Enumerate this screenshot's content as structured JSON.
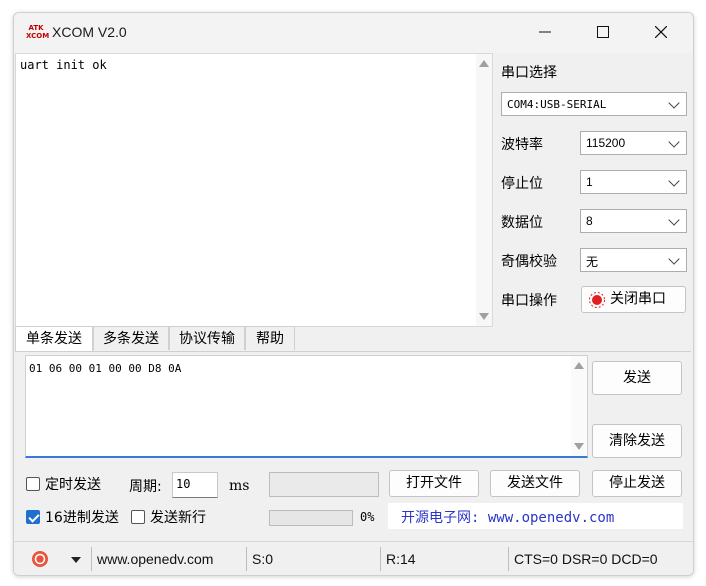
{
  "window": {
    "title": "XCOM V2.0",
    "icon_text_top": "ATK",
    "icon_text_bottom": "XCOM"
  },
  "controls": {
    "minimize": "—",
    "maximize": "☐",
    "close": "✕"
  },
  "receive": {
    "text": "uart init ok"
  },
  "config": {
    "port_select_label": "串口选择",
    "port_value": "COM4:USB-SERIAL",
    "baud_label": "波特率",
    "baud_value": "115200",
    "stopbits_label": "停止位",
    "stopbits_value": "1",
    "databits_label": "数据位",
    "databits_value": "8",
    "parity_label": "奇偶校验",
    "parity_value": "无",
    "port_op_label": "串口操作",
    "port_op_button": "关闭串口"
  },
  "tabs": [
    "单条发送",
    "多条发送",
    "协议传输",
    "帮助"
  ],
  "send": {
    "text": "01 06 00 01 00 00 D8 0A",
    "send_button": "发送",
    "clear_button": "清除发送"
  },
  "options": {
    "timed_send": "定时发送",
    "period_label": "周期:",
    "period_value": "10",
    "period_unit": "ms",
    "hex_send": "16进制发送",
    "newline": "发送新行",
    "progress_text": "0%",
    "open_file": "打开文件",
    "send_file": "发送文件",
    "stop_send": "停止发送",
    "website_banner": "开源电子网: www.openedv.com"
  },
  "status": {
    "website": "www.openedv.com",
    "sent": "S:0",
    "received": "R:14",
    "signals": "CTS=0 DSR=0 DCD=0"
  },
  "colors": {
    "accent": "#1f6fd1",
    "link": "#2a35c9",
    "alert": "#e02020"
  }
}
